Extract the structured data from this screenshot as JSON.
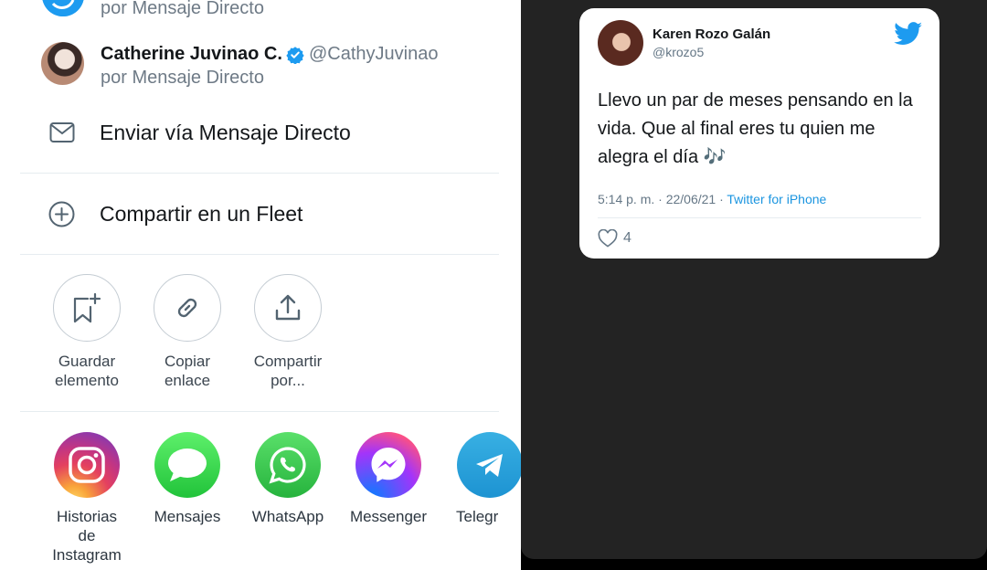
{
  "share_sheet": {
    "top_contact": {
      "subtitle": "por Mensaje Directo"
    },
    "contact": {
      "name": "Catherine Juvinao C.",
      "handle": "@CathyJuvinao",
      "subtitle": "por Mensaje Directo",
      "verified": true
    },
    "rows": [
      {
        "icon": "envelope-icon",
        "label": "Enviar vía Mensaje Directo"
      },
      {
        "icon": "plus-circle-icon",
        "label": "Compartir en un Fleet"
      }
    ],
    "actions": [
      {
        "icon": "bookmark-add-icon",
        "line1": "Guardar",
        "line2": "elemento"
      },
      {
        "icon": "link-icon",
        "line1": "Copiar",
        "line2": "enlace"
      },
      {
        "icon": "share-icon",
        "line1": "Compartir",
        "line2": "por..."
      }
    ],
    "apps": [
      {
        "icon": "instagram-icon",
        "line1": "Historias",
        "line2": "de",
        "line3": "Instagram"
      },
      {
        "icon": "messages-icon",
        "line1": "Mensajes"
      },
      {
        "icon": "whatsapp-icon",
        "line1": "WhatsApp"
      },
      {
        "icon": "messenger-icon",
        "line1": "Messenger"
      },
      {
        "icon": "telegram-icon",
        "line1": "Telegr"
      }
    ]
  },
  "tweet": {
    "author_name": "Karen Rozo Galán",
    "author_handle": "@krozo5",
    "text_line1": "Llevo un par de meses pensando en la",
    "text_line2": "vida. Que al final eres tu quien me",
    "text_line3": "alegra el día 🎶",
    "timestamp": "5:14 p. m. · 22/06/21 · ",
    "source": "Twitter for iPhone",
    "likes": "4"
  },
  "colors": {
    "twitter_blue": "#1d9bf0",
    "dark_background": "#232323",
    "text_secondary": "#6e7a86"
  }
}
